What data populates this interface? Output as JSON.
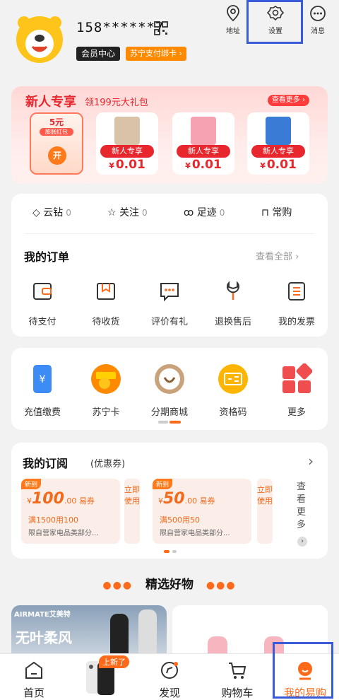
{
  "header": {
    "phone": "158******7",
    "member_center": "会员中心",
    "pay_card": "苏宁支付绑卡 ›",
    "top_icons": [
      {
        "name": "address",
        "label": "地址"
      },
      {
        "name": "settings",
        "label": "设置"
      },
      {
        "name": "messages",
        "label": "消息"
      }
    ]
  },
  "new_user": {
    "title": "新人专享",
    "subtitle": "领199元大礼包",
    "see_more": "查看更多 ›",
    "gift": {
      "amount": "5元",
      "label": "膨胀红包",
      "button": "开"
    },
    "products": [
      {
        "tag": "新人专享",
        "currency": "¥",
        "price": "0.01",
        "color": "#d8c2a8"
      },
      {
        "tag": "新人专享",
        "currency": "¥",
        "price": "0.01",
        "color": "#f5a3b3"
      },
      {
        "tag": "新人专享",
        "currency": "¥",
        "price": "0.01",
        "color": "#3a7bd5"
      }
    ]
  },
  "counts": [
    {
      "label": "云钻",
      "value": "0"
    },
    {
      "label": "关注",
      "value": "0"
    },
    {
      "label": "足迹",
      "value": "0"
    },
    {
      "label": "常购",
      "value": ""
    }
  ],
  "orders": {
    "title": "我的订单",
    "see_all": "查看全部",
    "items": [
      "待支付",
      "待收货",
      "评价有礼",
      "退换售后",
      "我的发票"
    ]
  },
  "services": {
    "items": [
      "充值缴费",
      "苏宁卡",
      "分期商城",
      "资格码",
      "更多"
    ]
  },
  "subscription": {
    "title": "我的订阅",
    "subtitle": "(优惠券)",
    "coupons": [
      {
        "badge": "新到",
        "currency": "¥",
        "amount": "100",
        "decimal": ".00",
        "type": "易券",
        "condition": "满1500用100",
        "desc": "限自营家电品类部分...",
        "side": "立即使用"
      },
      {
        "badge": "新到",
        "currency": "¥",
        "amount": "50",
        "decimal": ".00",
        "type": "易券",
        "condition": "满500用50",
        "desc": "限自营家电品类部分...",
        "side": "立即使用"
      }
    ],
    "see_more": "查看更多"
  },
  "featured": {
    "title": "精选好物",
    "brand": "AIRMATE艾美特",
    "promo": "无叶柔风"
  },
  "bottom_nav": {
    "items": [
      {
        "label": "首页"
      },
      {
        "label": "上新了",
        "badge": true
      },
      {
        "label": "发现"
      },
      {
        "label": "购物车"
      },
      {
        "label": "我的易购",
        "active": true
      }
    ]
  },
  "colors": {
    "accent": "#ff6a1a",
    "red": "#e8262e",
    "highlight": "#3a5bd9"
  }
}
